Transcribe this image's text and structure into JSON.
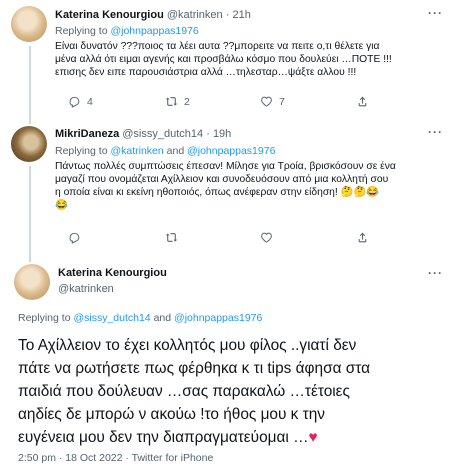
{
  "tweet1": {
    "name": "Katerina Kenourgiou",
    "handle": "@katrinken",
    "time": "21h",
    "separator": "·",
    "replying_label": "Replying to",
    "replying_to": "@johnpappas1976",
    "lines": [
      "Είναι δυνατόν ???ποιος τα λέει αυτα ??μπορειτε να πειτε ο,τι θέλετε για",
      "μένα αλλά ότι ειμαι αγενής και προσβάλω κόσμο που δουλεύει …ΠΟΤΕ !!!",
      "επισης δεν ειπε παρουσιάστρια αλλά …τηλεσταρ…ψάξτε αλλου !!!"
    ],
    "replies": "4",
    "retweets": "2",
    "likes": "7"
  },
  "tweet2": {
    "name": "MikriDaneza",
    "handle": "@sissy_dutch14",
    "time": "19h",
    "separator": "·",
    "replying_label": "Replying to",
    "replying_to_1": "@katrinken",
    "replying_and": "and",
    "replying_to_2": "@johnpappas1976",
    "lines": [
      "Πάντως πολλές συμπτώσεις έπεσαν! Μίλησε για Τροία, βρισκόσουν σε ένα",
      "μαγαζί που ονομάζεται Αχίλλειον και συνοδευόσουν από μια κολλητή σου",
      "η οποία είναι κι εκείνη ηθοποιός, όπως ανέφεραν στην είδηση! 🤔🤔😂",
      "😂"
    ]
  },
  "tweet3": {
    "name": "Katerina Kenourgiou",
    "handle": "@katrinken",
    "replying_label": "Replying to",
    "replying_to_1": "@sissy_dutch14",
    "replying_and": "and",
    "replying_to_2": "@johnpappas1976",
    "lines": [
      "Το Αχίλλειον το έχει κολλητός μου φίλος ..γιατί δεν",
      "πάτε να ρωτήσετε πως φέρθηκα κ τι tips άφησα στα",
      "παιδιά που δούλευαν …σας παρακαλώ …τέτοιες",
      "αηδίες δε μπορώ ν ακούω !το ήθος μου κ την",
      "ευγένεια μου δεν την διαπραγματεύομαι …"
    ],
    "heart": "♥",
    "meta": "2:50 pm · 18 Oct 2022 · Twitter for iPhone"
  },
  "colors": {
    "accent": "#1d9bf0",
    "secondary_text": "#536471",
    "heart": "#e0245e"
  },
  "icons": [
    "reply-icon",
    "retweet-icon",
    "like-icon",
    "share-icon",
    "more-icon"
  ]
}
